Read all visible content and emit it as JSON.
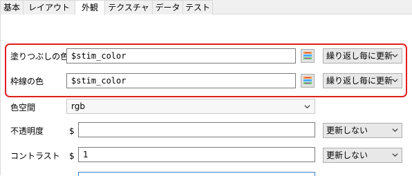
{
  "tabs": [
    {
      "label": "基本",
      "active": false
    },
    {
      "label": "レイアウト",
      "active": false
    },
    {
      "label": "外観",
      "active": true
    },
    {
      "label": "テクスチャ",
      "active": false
    },
    {
      "label": "データ",
      "active": false
    },
    {
      "label": "テスト",
      "active": false
    }
  ],
  "fill_color": {
    "label": "塗りつぶしの色",
    "value": "$stim_color",
    "update": "繰り返し毎に更新"
  },
  "border_color": {
    "label": "枠線の色",
    "value": "$stim_color",
    "update": "繰り返し毎に更新"
  },
  "color_space": {
    "label": "色空間",
    "value": "rgb"
  },
  "opacity": {
    "label": "不透明度",
    "prefix": "$",
    "value": "",
    "update": "更新しない"
  },
  "contrast": {
    "label": "コントラスト",
    "prefix": "$",
    "value": "1",
    "update": "更新しない"
  },
  "colors": {
    "highlight": "#e01e1e",
    "field_border": "#7a7a7a"
  },
  "icons": {
    "color_picker": "color-picker-icon",
    "dropdown": "chevron-down-icon"
  }
}
